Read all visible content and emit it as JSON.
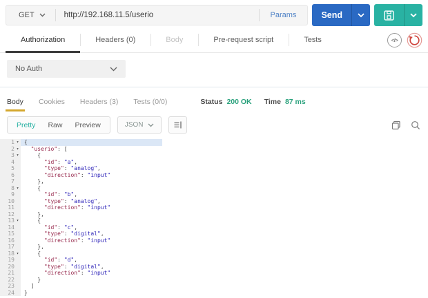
{
  "request": {
    "method": "GET",
    "url": "http://192.168.11.5/userio",
    "params_label": "Params",
    "send_label": "Send"
  },
  "request_tabs": [
    {
      "label": "Authorization",
      "state": "active"
    },
    {
      "label": "Headers (0)",
      "state": "normal"
    },
    {
      "label": "Body",
      "state": "disabled"
    },
    {
      "label": "Pre-request script",
      "state": "normal"
    },
    {
      "label": "Tests",
      "state": "normal"
    }
  ],
  "auth": {
    "selected": "No Auth"
  },
  "response": {
    "tabs": [
      {
        "label": "Body",
        "state": "active"
      },
      {
        "label": "Cookies",
        "state": "normal"
      },
      {
        "label": "Headers (3)",
        "state": "normal"
      },
      {
        "label": "Tests (0/0)",
        "state": "normal"
      }
    ],
    "status_label": "Status",
    "status_value": "200 OK",
    "time_label": "Time",
    "time_value": "87 ms",
    "view_modes": [
      {
        "label": "Pretty",
        "state": "active"
      },
      {
        "label": "Raw",
        "state": "normal"
      },
      {
        "label": "Preview",
        "state": "normal"
      }
    ],
    "language": "JSON"
  },
  "colors": {
    "send_button": "#2a69c3",
    "save_button": "#29b2a3",
    "params_link": "#4f82c6",
    "status_green": "#29a17c",
    "response_tab_underline": "#d4a72c",
    "request_tab_underline": "#3d3d3d",
    "pretty_active": "#26b0a2",
    "reset_icon": "#d0453e",
    "code_key": "#96274b",
    "code_value": "#2d23b8",
    "active_line_bg": "#dbe7f6"
  },
  "code": {
    "lines": [
      {
        "n": 1,
        "fold": true,
        "active": true,
        "t": [
          [
            "p",
            "{"
          ]
        ]
      },
      {
        "n": 2,
        "fold": true,
        "t": [
          [
            "p",
            "  "
          ],
          [
            "k",
            "\"userio\""
          ],
          [
            "p",
            ": ["
          ]
        ]
      },
      {
        "n": 3,
        "fold": true,
        "t": [
          [
            "p",
            "    {"
          ]
        ]
      },
      {
        "n": 4,
        "t": [
          [
            "p",
            "      "
          ],
          [
            "k",
            "\"id\""
          ],
          [
            "p",
            ": "
          ],
          [
            "v",
            "\"a\""
          ],
          [
            "p",
            ","
          ]
        ]
      },
      {
        "n": 5,
        "t": [
          [
            "p",
            "      "
          ],
          [
            "k",
            "\"type\""
          ],
          [
            "p",
            ": "
          ],
          [
            "v",
            "\"analog\""
          ],
          [
            "p",
            ","
          ]
        ]
      },
      {
        "n": 6,
        "t": [
          [
            "p",
            "      "
          ],
          [
            "k",
            "\"direction\""
          ],
          [
            "p",
            ": "
          ],
          [
            "v",
            "\"input\""
          ]
        ]
      },
      {
        "n": 7,
        "t": [
          [
            "p",
            "    },"
          ]
        ]
      },
      {
        "n": 8,
        "fold": true,
        "t": [
          [
            "p",
            "    {"
          ]
        ]
      },
      {
        "n": 9,
        "t": [
          [
            "p",
            "      "
          ],
          [
            "k",
            "\"id\""
          ],
          [
            "p",
            ": "
          ],
          [
            "v",
            "\"b\""
          ],
          [
            "p",
            ","
          ]
        ]
      },
      {
        "n": 10,
        "t": [
          [
            "p",
            "      "
          ],
          [
            "k",
            "\"type\""
          ],
          [
            "p",
            ": "
          ],
          [
            "v",
            "\"analog\""
          ],
          [
            "p",
            ","
          ]
        ]
      },
      {
        "n": 11,
        "t": [
          [
            "p",
            "      "
          ],
          [
            "k",
            "\"direction\""
          ],
          [
            "p",
            ": "
          ],
          [
            "v",
            "\"input\""
          ]
        ]
      },
      {
        "n": 12,
        "t": [
          [
            "p",
            "    },"
          ]
        ]
      },
      {
        "n": 13,
        "fold": true,
        "t": [
          [
            "p",
            "    {"
          ]
        ]
      },
      {
        "n": 14,
        "t": [
          [
            "p",
            "      "
          ],
          [
            "k",
            "\"id\""
          ],
          [
            "p",
            ": "
          ],
          [
            "v",
            "\"c\""
          ],
          [
            "p",
            ","
          ]
        ]
      },
      {
        "n": 15,
        "t": [
          [
            "p",
            "      "
          ],
          [
            "k",
            "\"type\""
          ],
          [
            "p",
            ": "
          ],
          [
            "v",
            "\"digital\""
          ],
          [
            "p",
            ","
          ]
        ]
      },
      {
        "n": 16,
        "t": [
          [
            "p",
            "      "
          ],
          [
            "k",
            "\"direction\""
          ],
          [
            "p",
            ": "
          ],
          [
            "v",
            "\"input\""
          ]
        ]
      },
      {
        "n": 17,
        "t": [
          [
            "p",
            "    },"
          ]
        ]
      },
      {
        "n": 18,
        "fold": true,
        "t": [
          [
            "p",
            "    {"
          ]
        ]
      },
      {
        "n": 19,
        "t": [
          [
            "p",
            "      "
          ],
          [
            "k",
            "\"id\""
          ],
          [
            "p",
            ": "
          ],
          [
            "v",
            "\"d\""
          ],
          [
            "p",
            ","
          ]
        ]
      },
      {
        "n": 20,
        "t": [
          [
            "p",
            "      "
          ],
          [
            "k",
            "\"type\""
          ],
          [
            "p",
            ": "
          ],
          [
            "v",
            "\"digital\""
          ],
          [
            "p",
            ","
          ]
        ]
      },
      {
        "n": 21,
        "t": [
          [
            "p",
            "      "
          ],
          [
            "k",
            "\"direction\""
          ],
          [
            "p",
            ": "
          ],
          [
            "v",
            "\"input\""
          ]
        ]
      },
      {
        "n": 22,
        "t": [
          [
            "p",
            "    }"
          ]
        ]
      },
      {
        "n": 23,
        "t": [
          [
            "p",
            "  ]"
          ]
        ]
      },
      {
        "n": 24,
        "t": [
          [
            "p",
            "}"
          ]
        ]
      }
    ]
  }
}
